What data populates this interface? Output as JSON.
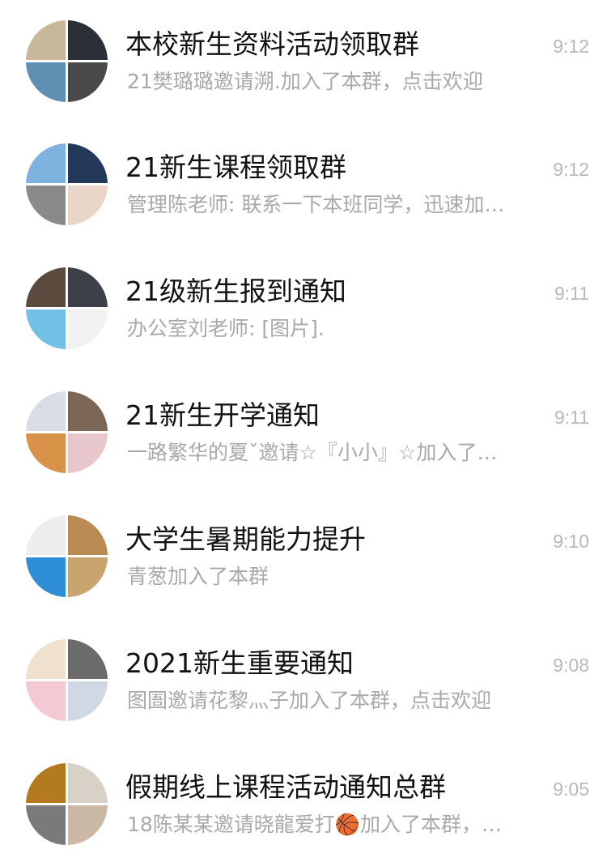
{
  "chats": [
    {
      "title": "本校新生资料活动领取群",
      "time": "9:12",
      "preview": "21樊璐璐邀请溯.加入了本群，点击欢迎",
      "avatar_colors": [
        "#c9b79c",
        "#2b3036",
        "#5f8fb3",
        "#4a4a4a"
      ]
    },
    {
      "title": "21新生课程领取群",
      "time": "9:12",
      "preview": "管理陈老师: 联系一下本班同学，迅速加…",
      "avatar_colors": [
        "#7fb3df",
        "#24395a",
        "#8a8a8a",
        "#e9d6c8"
      ]
    },
    {
      "title": "21级新生报到通知",
      "time": "9:11",
      "preview": "办公室刘老师: [图片].",
      "avatar_colors": [
        "#5b4a3e",
        "#3d4147",
        "#72c0e6",
        "#f1f1f1"
      ]
    },
    {
      "title": "21新生开学通知",
      "time": "9:11",
      "preview": "一路繁华的夏ˇ邀请☆『小小』☆加入了…",
      "avatar_colors": [
        "#d9dee6",
        "#7c6656",
        "#d99348",
        "#e7c7cc"
      ]
    },
    {
      "title": "大学生暑期能力提升",
      "time": "9:10",
      "preview": "青葱加入了本群",
      "avatar_colors": [
        "#eeeeee",
        "#b98b52",
        "#2e8fd6",
        "#c9a46e"
      ]
    },
    {
      "title": "2021新生重要通知",
      "time": "9:08",
      "preview": "图圄邀请花黎灬子加入了本群，点击欢迎",
      "avatar_colors": [
        "#f0e1cf",
        "#6b6b6b",
        "#f3c9d3",
        "#cfd8e3"
      ]
    },
    {
      "title": "假期线上课程活动通知总群",
      "time": "9:05",
      "preview": "18陈某某邀请晓龍爱打🏀加入了本群，…",
      "avatar_colors": [
        "#b37a1f",
        "#d8d1c7",
        "#7a7a7a",
        "#cbb8a5"
      ]
    }
  ]
}
